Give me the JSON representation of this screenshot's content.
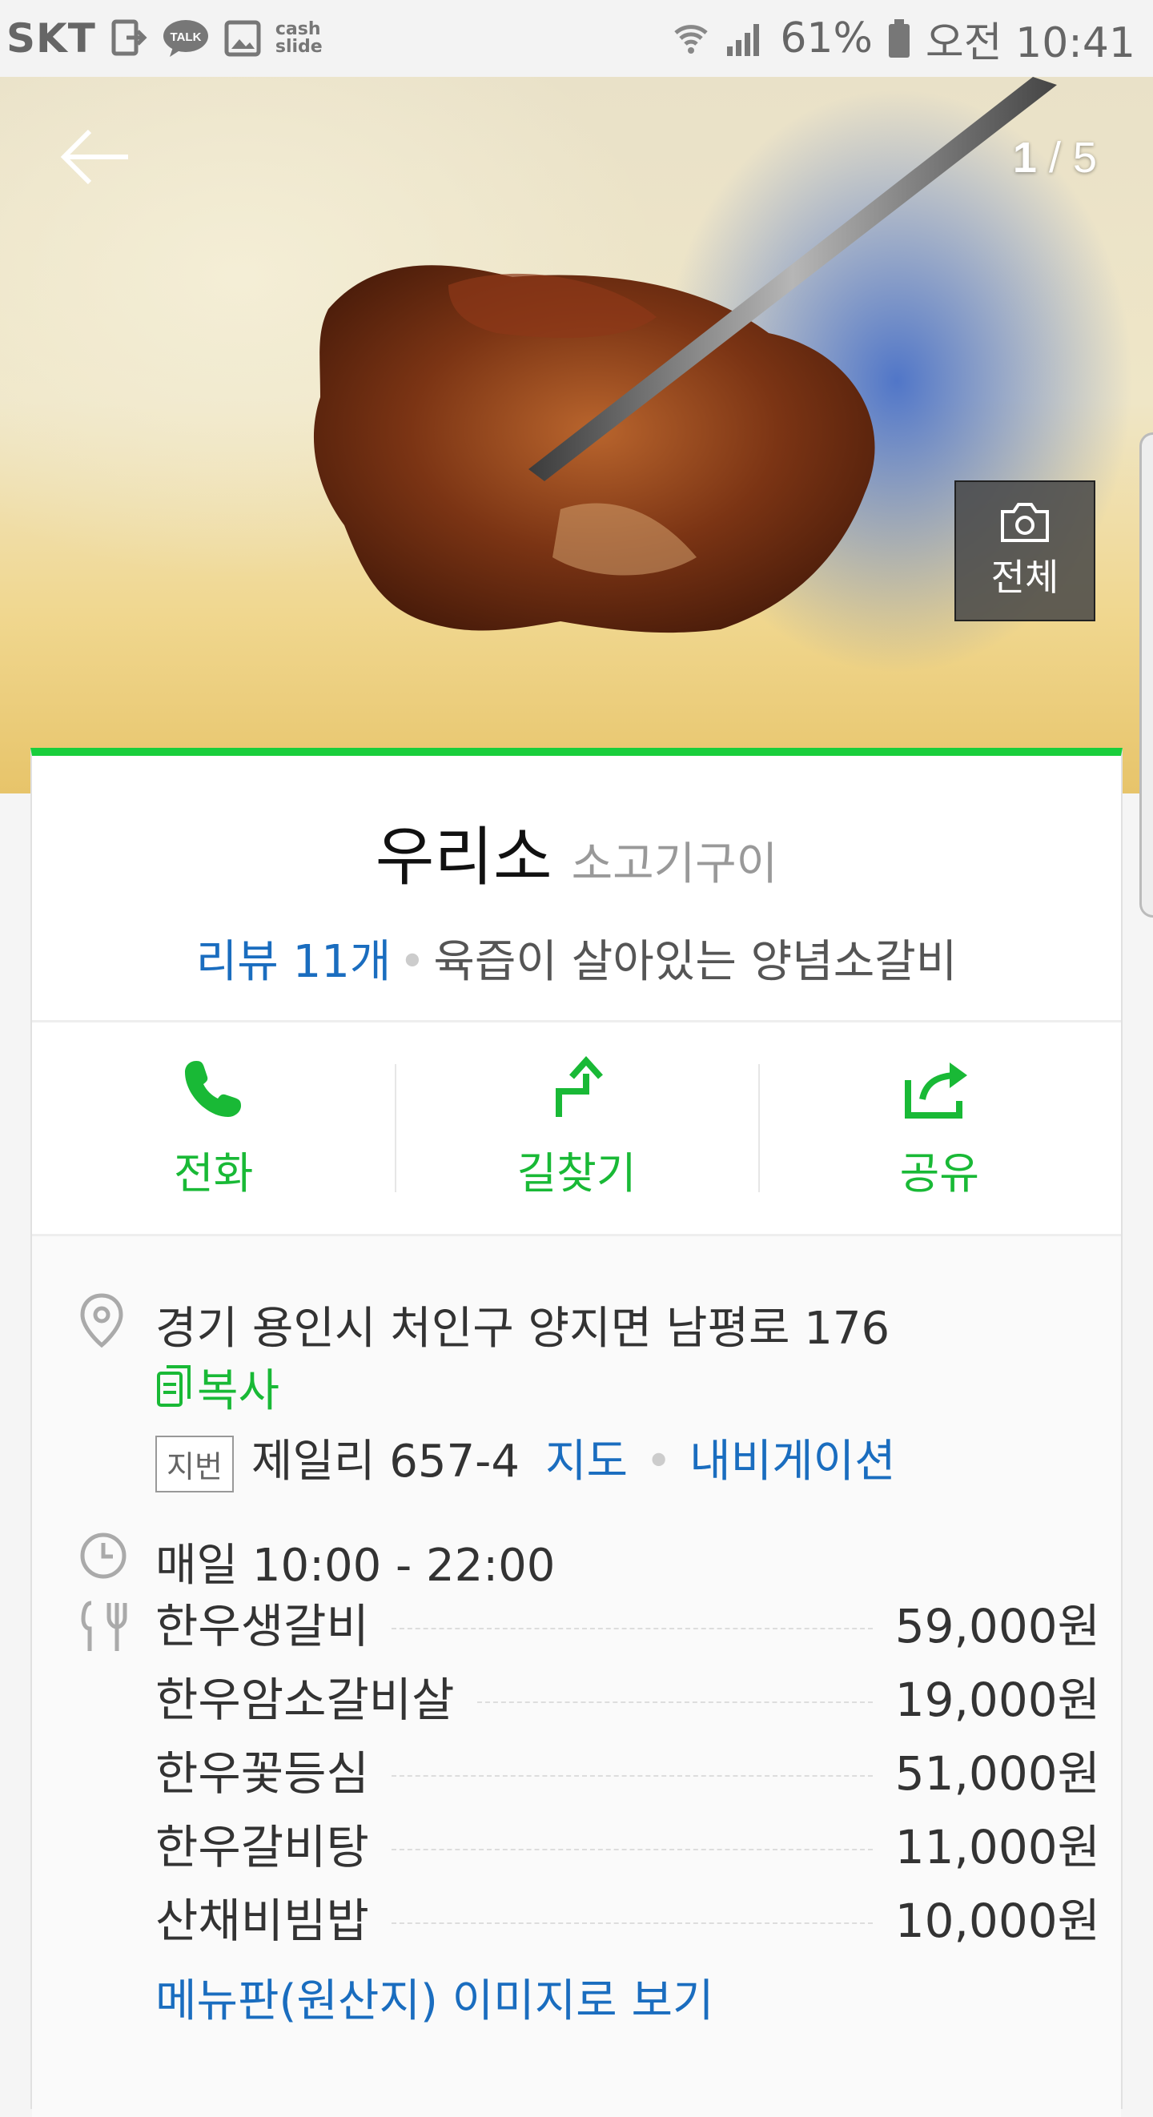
{
  "status_bar": {
    "carrier": "SKT",
    "talk_label": "TALK",
    "cashslide_label": "cash slide",
    "battery_pct": "61%",
    "time": "오전 10:41"
  },
  "hero": {
    "counter_current": "1",
    "counter_sep": " / ",
    "counter_total": "5",
    "view_all_label": "전체"
  },
  "place": {
    "name": "우리소",
    "category": "소고기구이",
    "review_link": "리뷰 11개",
    "tagline": "육즙이 살아있는 양념소갈비"
  },
  "actions": [
    {
      "label": "전화",
      "icon": "phone-icon"
    },
    {
      "label": "길찾기",
      "icon": "directions-icon"
    },
    {
      "label": "공유",
      "icon": "share-icon"
    }
  ],
  "info": {
    "address": "경기 용인시 처인구 양지면 남평로 176",
    "copy_label": "복사",
    "jibeon_badge": "지번",
    "jibeon_address": "제일리 657-4",
    "map_link": "지도",
    "nav_link": "내비게이션",
    "hours": "매일 10:00 - 22:00",
    "menu": [
      {
        "name": "한우생갈비",
        "price": "59,000원"
      },
      {
        "name": "한우암소갈비살",
        "price": "19,000원"
      },
      {
        "name": "한우꽃등심",
        "price": "51,000원"
      },
      {
        "name": "한우갈비탕",
        "price": "11,000원"
      },
      {
        "name": "산채비빔밥",
        "price": "10,000원"
      }
    ],
    "menu_board_link": "메뉴판(원산지) 이미지로 보기"
  },
  "colors": {
    "accent_green": "#19ce3c",
    "link_blue": "#1a6dbf"
  }
}
